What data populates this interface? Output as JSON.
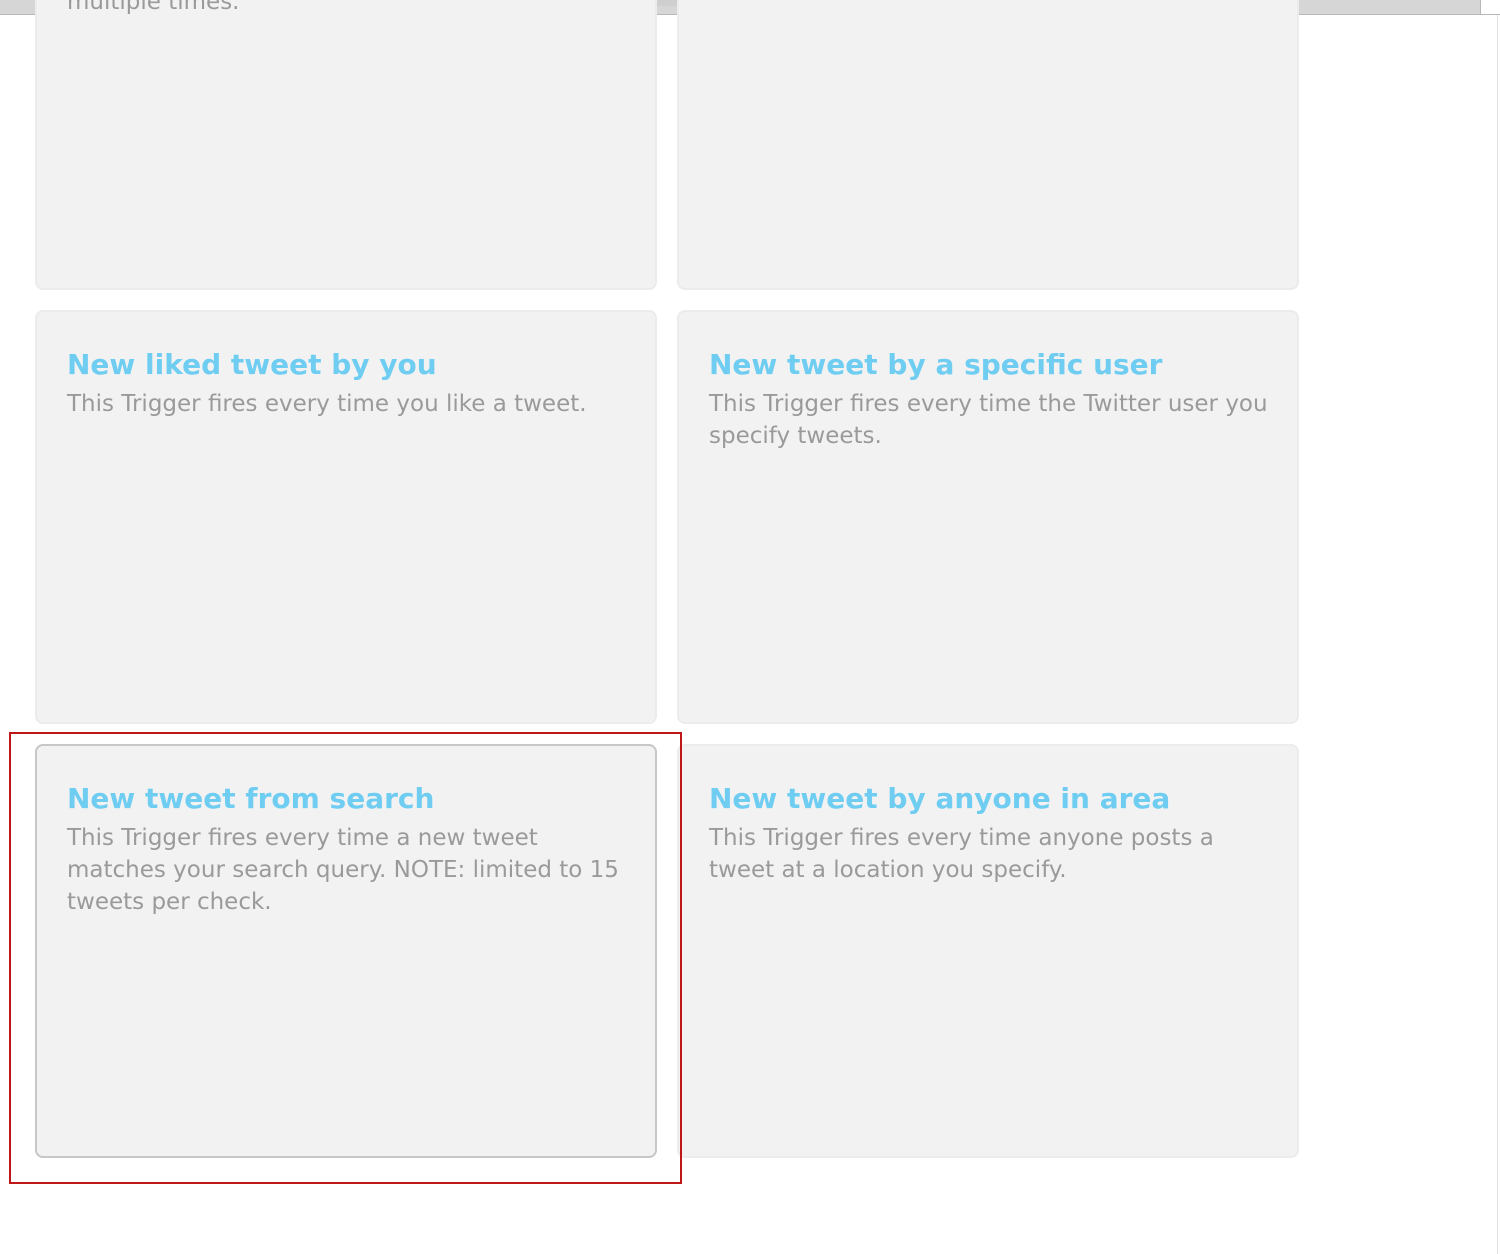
{
  "cards": {
    "top_left": {
      "title": "",
      "description": "multiple times."
    },
    "top_right": {
      "title": "",
      "description": ""
    },
    "liked_tweet": {
      "title": "New liked tweet by you",
      "description": "This Trigger fires every time you like a tweet."
    },
    "specific_user": {
      "title": "New tweet by a specific user",
      "description": "This Trigger fires every time the Twitter user you specify tweets."
    },
    "from_search": {
      "title": "New tweet from search",
      "description": "This Trigger fires every time a new tweet matches your search query. NOTE: limited to 15 tweets per check."
    },
    "anyone_in_area": {
      "title": "New tweet by anyone in area",
      "description": "This Trigger fires every time anyone posts a tweet at a location you specify."
    }
  },
  "colors": {
    "title": "#6fcdf2",
    "description": "#9a9a9a",
    "card_background": "#f2f2f2",
    "highlight": "#c01818"
  }
}
